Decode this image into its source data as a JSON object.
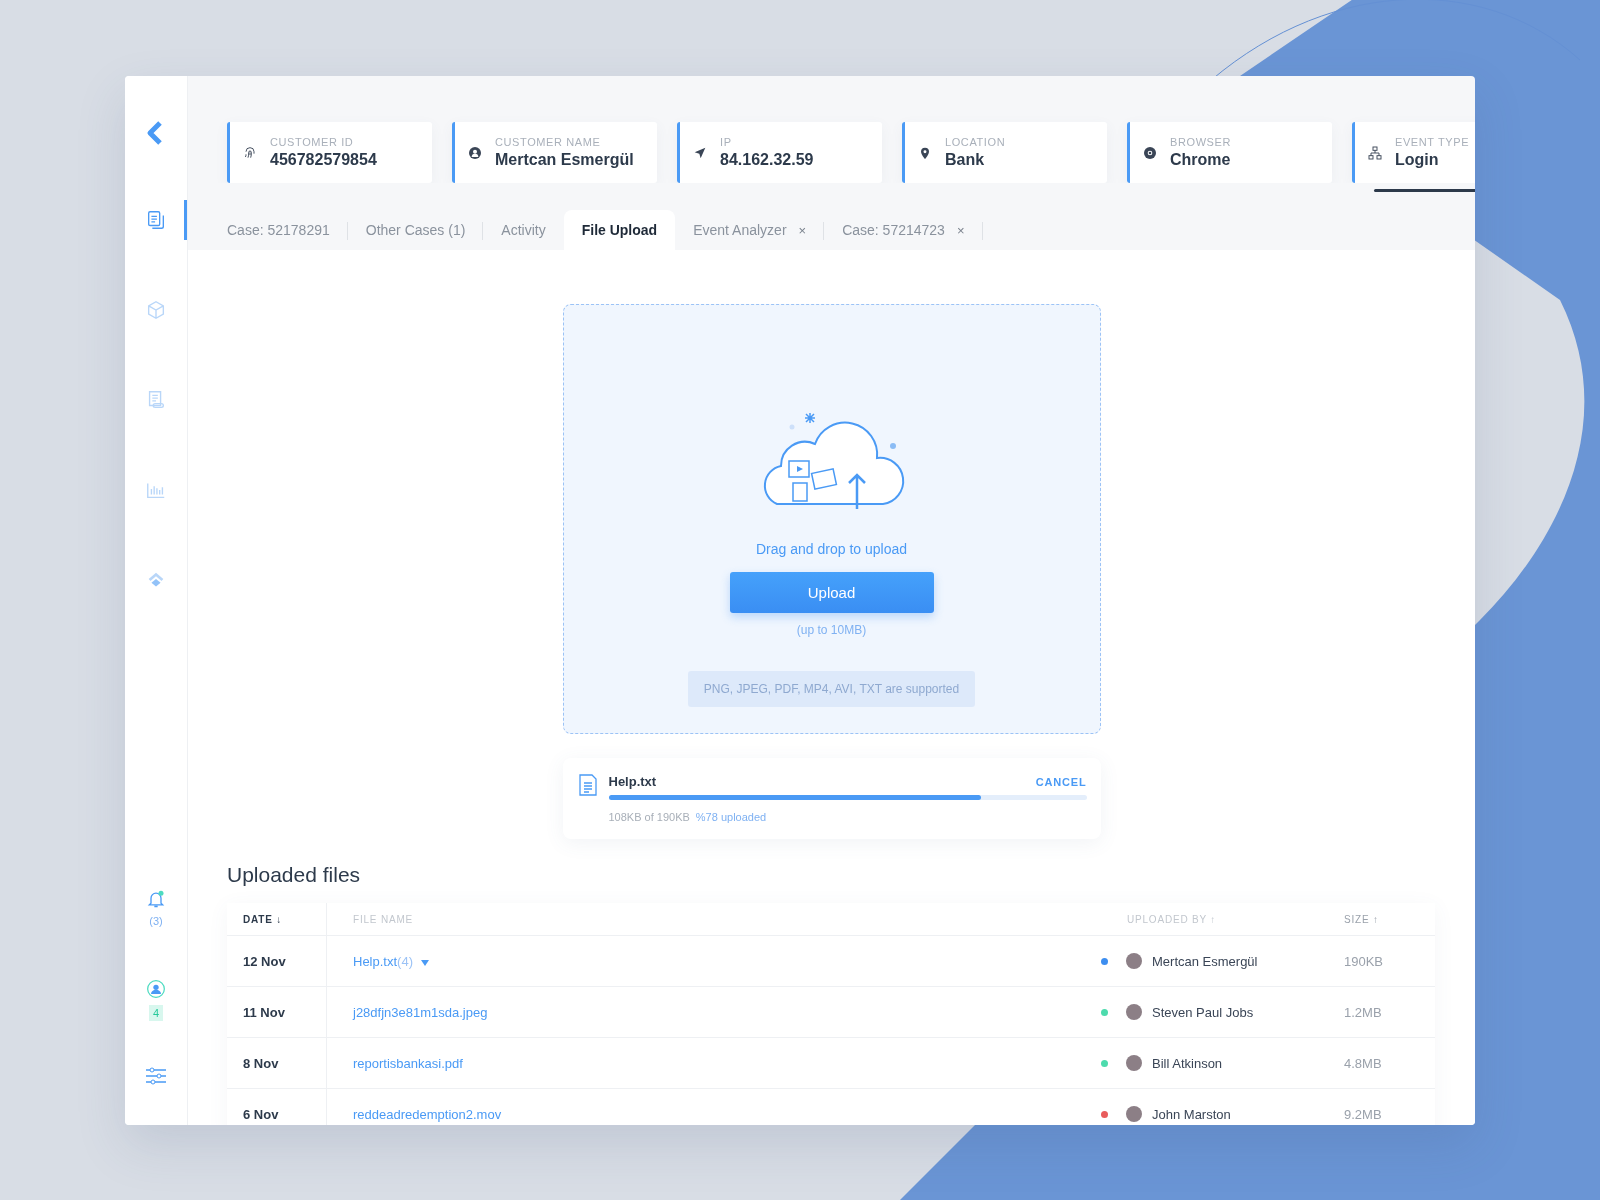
{
  "sidebar": {
    "items": [
      {
        "kind": "documents",
        "selected": true
      },
      {
        "kind": "cube",
        "selected": false
      },
      {
        "kind": "receipt",
        "selected": false
      },
      {
        "kind": "chart",
        "selected": false
      },
      {
        "kind": "layers",
        "selected": false
      }
    ],
    "notifications": {
      "count": "(3)",
      "unread": true
    },
    "profile": {
      "badge": "4"
    }
  },
  "info_cards": [
    {
      "kind": "fingerprint",
      "label": "CUSTOMER ID",
      "value": "456782579854"
    },
    {
      "kind": "user",
      "label": "CUSTOMER NAME",
      "value": "Mertcan Esmergül"
    },
    {
      "kind": "navigation",
      "label": "IP",
      "value": "84.162.32.59"
    },
    {
      "kind": "pin",
      "label": "LOCATION",
      "value": "Bank"
    },
    {
      "kind": "browser",
      "label": "BROWSER",
      "value": "Chrome"
    },
    {
      "kind": "network",
      "label": "EVENT TYPE",
      "value": "Login"
    }
  ],
  "tabs": [
    {
      "label": "Case: 52178291",
      "selected": false
    },
    {
      "label": "Other Cases (1)",
      "selected": false
    },
    {
      "label": "Activity",
      "selected": false
    },
    {
      "label": "File Upload",
      "selected": true
    },
    {
      "label": "Event Analyzer",
      "selected": false,
      "close": "×"
    },
    {
      "label": "Case: 57214723",
      "selected": false,
      "close": "×"
    }
  ],
  "dropzone": {
    "prompt": "Drag and drop to upload",
    "button": "Upload",
    "limit": "(up to 10MB)",
    "formats": "PNG, JPEG, PDF, MP4, AVI, TXT are supported"
  },
  "upload": {
    "file": "Help.txt",
    "cancel": "CANCEL",
    "level": 0.78,
    "size": "108KB of 190KB",
    "progress": "%78 uploaded"
  },
  "uploaded_files": {
    "title": "Uploaded files",
    "columns": [
      {
        "label": "DATE",
        "sort": "↓",
        "active": true
      },
      {
        "label": "FILE NAME",
        "active": false
      },
      {
        "label": "UPLOADED BY",
        "sort": "↑",
        "active": false
      },
      {
        "label": "SIZE",
        "sort": "↑",
        "active": false
      }
    ],
    "rows": [
      {
        "date": "12 Nov",
        "file": "Help.txt",
        "versions": "(4)",
        "color": "#3d8ef0",
        "user": "Mertcan Esmergül",
        "size": "190KB"
      },
      {
        "date": "11 Nov",
        "file": "j28dfjn3e81m1sda.jpeg",
        "color": "#4ddbad",
        "user": "Steven Paul Jobs",
        "size": "1.2MB"
      },
      {
        "date": "8 Nov",
        "file": "reportisbankasi.pdf",
        "color": "#4ddbad",
        "user": "Bill Atkinson",
        "size": "4.8MB"
      },
      {
        "date": "6 Nov",
        "file": "reddeadredemption2.mov",
        "color": "#e85c5c",
        "user": "John Marston",
        "size": "9.2MB"
      }
    ]
  }
}
